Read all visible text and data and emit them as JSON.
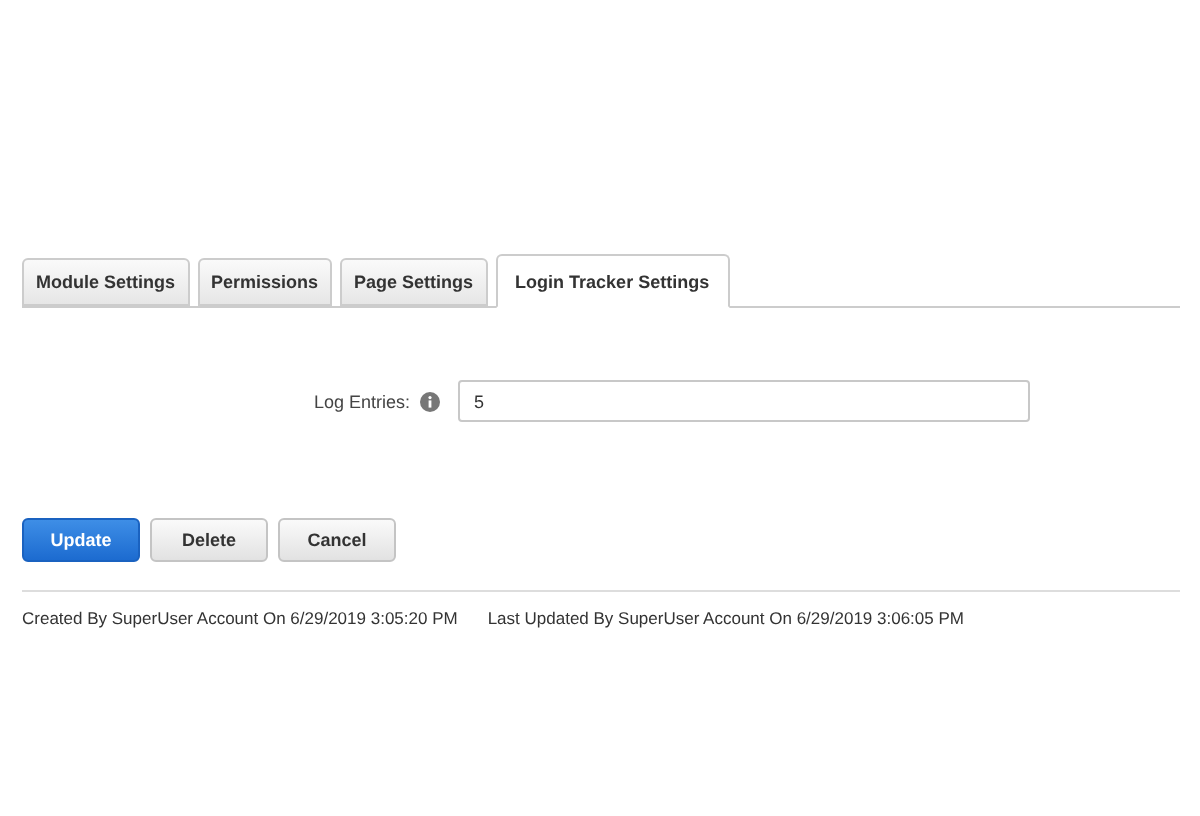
{
  "tabs": [
    {
      "label": "Module Settings",
      "selected": false
    },
    {
      "label": "Permissions",
      "selected": false
    },
    {
      "label": "Page Settings",
      "selected": false
    },
    {
      "label": "Login Tracker Settings",
      "selected": true
    }
  ],
  "form": {
    "label": "Log Entries:",
    "value": "5"
  },
  "buttons": [
    {
      "label": "Update",
      "kind": "primary"
    },
    {
      "label": "Delete",
      "kind": "secondary"
    },
    {
      "label": "Cancel",
      "kind": "secondary"
    }
  ],
  "footer": {
    "created": "Created By SuperUser Account On 6/29/2019 3:05:20 PM",
    "updated": "Last Updated By SuperUser Account On 6/29/2019 3:06:05 PM"
  }
}
